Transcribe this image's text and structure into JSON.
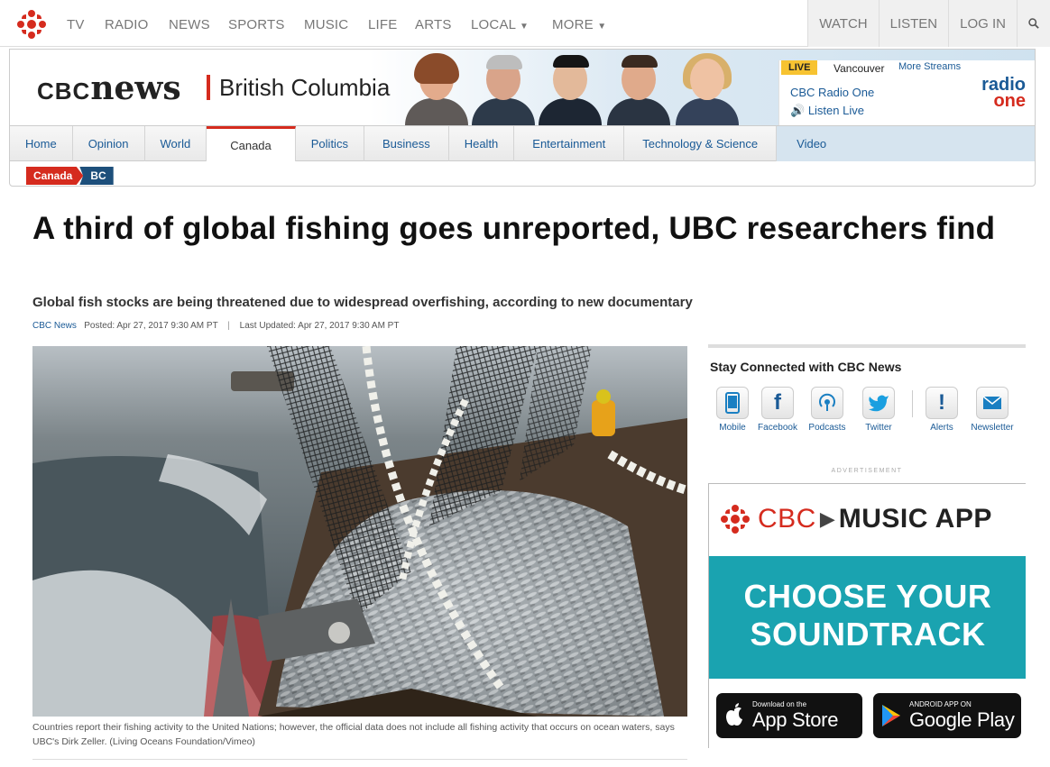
{
  "topnav": {
    "logo": "cbc-gem-logo",
    "items": [
      "TV",
      "RADIO",
      "NEWS",
      "SPORTS",
      "MUSIC",
      "LIFE",
      "ARTS",
      "LOCAL",
      "MORE"
    ],
    "right": [
      "WATCH",
      "LISTEN",
      "LOG IN"
    ]
  },
  "header": {
    "brand_cbc": "CBC",
    "brand_news": "news",
    "region": "British Columbia",
    "live": {
      "tag": "LIVE",
      "city": "Vancouver",
      "more_streams": "More Streams",
      "station": "CBC Radio One",
      "listen": "Listen Live",
      "logo_top": "radio",
      "logo_bottom": "one"
    }
  },
  "sections": [
    "Home",
    "Opinion",
    "World",
    "Canada",
    "Politics",
    "Business",
    "Health",
    "Entertainment",
    "Technology & Science",
    "Video"
  ],
  "active_section": "Canada",
  "breadcrumb": [
    "Canada",
    "BC"
  ],
  "article": {
    "headline": "A third of global fishing goes unreported, UBC researchers find",
    "subhead": "Global fish stocks are being threatened due to widespread overfishing, according to new documentary",
    "source": "CBC News",
    "posted": "Posted: Apr 27, 2017 9:30 AM PT",
    "separator": "|",
    "updated": "Last Updated: Apr 27, 2017 9:30 AM PT",
    "caption": "Countries report their fishing activity to the United Nations; however, the official data does not include all fishing activity that occurs on ocean waters, says UBC's Dirk Zeller. (Living Oceans Foundation/Vimeo)"
  },
  "sidebar": {
    "title": "Stay Connected with CBC News",
    "social": [
      {
        "label": "Mobile",
        "icon": "mobile-icon"
      },
      {
        "label": "Facebook",
        "icon": "facebook-icon"
      },
      {
        "label": "Podcasts",
        "icon": "podcast-icon"
      },
      {
        "label": "Twitter",
        "icon": "twitter-icon"
      },
      {
        "label": "Alerts",
        "icon": "alert-icon"
      },
      {
        "label": "Newsletter",
        "icon": "envelope-icon"
      }
    ],
    "advertisement": "ADVERTISEMENT",
    "ad": {
      "brand": "CBC",
      "product": "MUSIC APP",
      "line1": "CHOOSE YOUR",
      "line2": "SOUNDTRACK",
      "apple_small": "Download on the",
      "apple_big": "App Store",
      "google_small": "ANDROID APP ON",
      "google_big": "Google Play"
    }
  },
  "colors": {
    "cbc_red": "#d52b1e",
    "link_blue": "#1a5a96",
    "live_yellow": "#f7c331",
    "ad_teal": "#1aa3b0",
    "breadcrumb_navy": "#1d4f7b"
  }
}
